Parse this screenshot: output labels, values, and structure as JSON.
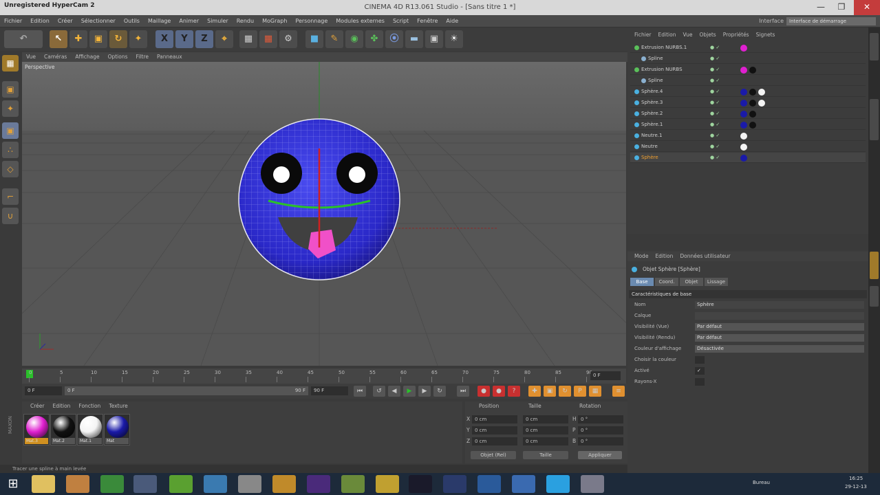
{
  "titlebar": {
    "app_label": "Unregistered HyperCam 2",
    "title": "CINEMA 4D R13.061 Studio - [Sans titre 1 *]"
  },
  "menubar": {
    "items": [
      "Fichier",
      "Edition",
      "Créer",
      "Sélectionner",
      "Outils",
      "Maillage",
      "Animer",
      "Simuler",
      "Rendu",
      "MoGraph",
      "Personnage",
      "Modules externes",
      "Script",
      "Fenêtre",
      "Aide"
    ],
    "layout_label": "Interface",
    "layout_value": "Interface de démarrage"
  },
  "toolbar": {
    "axis_x": "X",
    "axis_y": "Y",
    "axis_z": "Z"
  },
  "viewport": {
    "menu": [
      "Vue",
      "Caméras",
      "Affichage",
      "Options",
      "Filtre",
      "Panneaux"
    ],
    "label": "Perspective"
  },
  "timeline": {
    "ticks": [
      "0",
      "5",
      "10",
      "15",
      "20",
      "25",
      "30",
      "35",
      "40",
      "45",
      "50",
      "55",
      "60",
      "65",
      "70",
      "75",
      "80",
      "85",
      "90"
    ],
    "end_field": "0 F",
    "start_field": "0 F",
    "range_start": "0 F",
    "range_end": "90 F",
    "max_field": "90 F"
  },
  "materials": {
    "menu": [
      "Créer",
      "Edition",
      "Fonction",
      "Texture"
    ],
    "items": [
      {
        "label": "Mat.3",
        "color": "#e020d0"
      },
      {
        "label": "Mat.2",
        "color": "#111111"
      },
      {
        "label": "Mat.1",
        "color": "#f4f4f4"
      },
      {
        "label": "Mat",
        "color": "#1a1aa8"
      }
    ]
  },
  "coords": {
    "headers": [
      "Position",
      "Taille",
      "Rotation"
    ],
    "rows": [
      {
        "axis": "X",
        "pos": "0 cm",
        "size": "0 cm",
        "rot_axis": "H",
        "rot": "0 °"
      },
      {
        "axis": "Y",
        "pos": "0 cm",
        "size": "0 cm",
        "rot_axis": "P",
        "rot": "0 °"
      },
      {
        "axis": "Z",
        "pos": "0 cm",
        "size": "0 cm",
        "rot_axis": "B",
        "rot": "0 °"
      }
    ],
    "mode_select": "Objet (Rel)",
    "size_select": "Taille",
    "apply_button": "Appliquer"
  },
  "statusbar": {
    "text": "Tracer une spline à main levée"
  },
  "object_manager": {
    "menu": [
      "Fichier",
      "Edition",
      "Vue",
      "Objets",
      "Propriétés",
      "Signets"
    ],
    "rows": [
      {
        "name": "Extrusion NURBS.1",
        "indent": 1,
        "active": false
      },
      {
        "name": "Spline",
        "indent": 2,
        "active": false
      },
      {
        "name": "Extrusion NURBS",
        "indent": 1,
        "active": false
      },
      {
        "name": "Spline",
        "indent": 2,
        "active": false
      },
      {
        "name": "Sphère.4",
        "indent": 1,
        "active": false
      },
      {
        "name": "Sphère.3",
        "indent": 1,
        "active": false
      },
      {
        "name": "Sphère.2",
        "indent": 1,
        "active": false
      },
      {
        "name": "Sphère.1",
        "indent": 1,
        "active": false
      },
      {
        "name": "Neutre.1",
        "indent": 1,
        "active": false
      },
      {
        "name": "Neutre",
        "indent": 1,
        "active": false
      },
      {
        "name": "Sphère",
        "indent": 1,
        "active": true
      }
    ]
  },
  "attributes": {
    "menu": [
      "Mode",
      "Edition",
      "Données utilisateur"
    ],
    "object_title": "Objet Sphère [Sphère]",
    "tabs": [
      "Base",
      "Coord.",
      "Objet",
      "Lissage"
    ],
    "section": "Caractéristiques de base",
    "fields": [
      {
        "label": "Nom",
        "value": "Sphère"
      },
      {
        "label": "Calque",
        "value": ""
      },
      {
        "label": "Visibilité (Vue)",
        "value": "Par défaut"
      },
      {
        "label": "Visibilité (Rendu)",
        "value": "Par défaut"
      },
      {
        "label": "Couleur d'affichage",
        "value": "Désactivée"
      },
      {
        "label": "Choisir la couleur",
        "value": ""
      },
      {
        "label": "Activé",
        "value": "✓"
      },
      {
        "label": "Rayons-X",
        "value": ""
      }
    ]
  },
  "taskbar": {
    "tray_label": "Bureau",
    "time": "16:25",
    "date": "29-12-13"
  }
}
